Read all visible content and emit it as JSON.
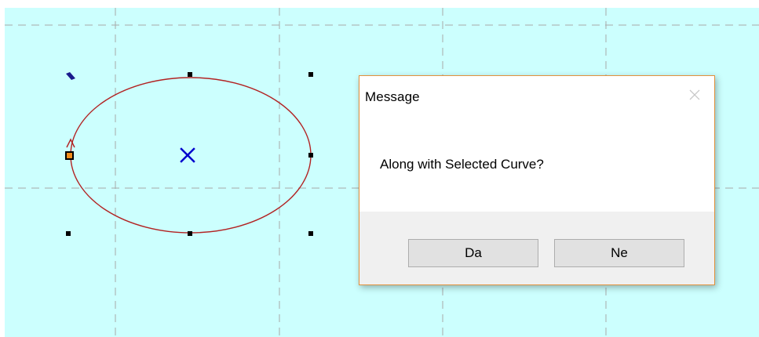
{
  "canvas": {
    "background_color": "#ccfffe",
    "grid_color": "#a8a8a8",
    "curve_color": "#b22222",
    "center_marker_color": "#0000cc",
    "curve_shape": "ellipse"
  },
  "dialog": {
    "title": "Message",
    "message": "Along with Selected Curve?",
    "close_icon": "close-icon",
    "buttons": {
      "yes_label": "Da",
      "no_label": "Ne"
    },
    "border_color": "#e1913d"
  }
}
